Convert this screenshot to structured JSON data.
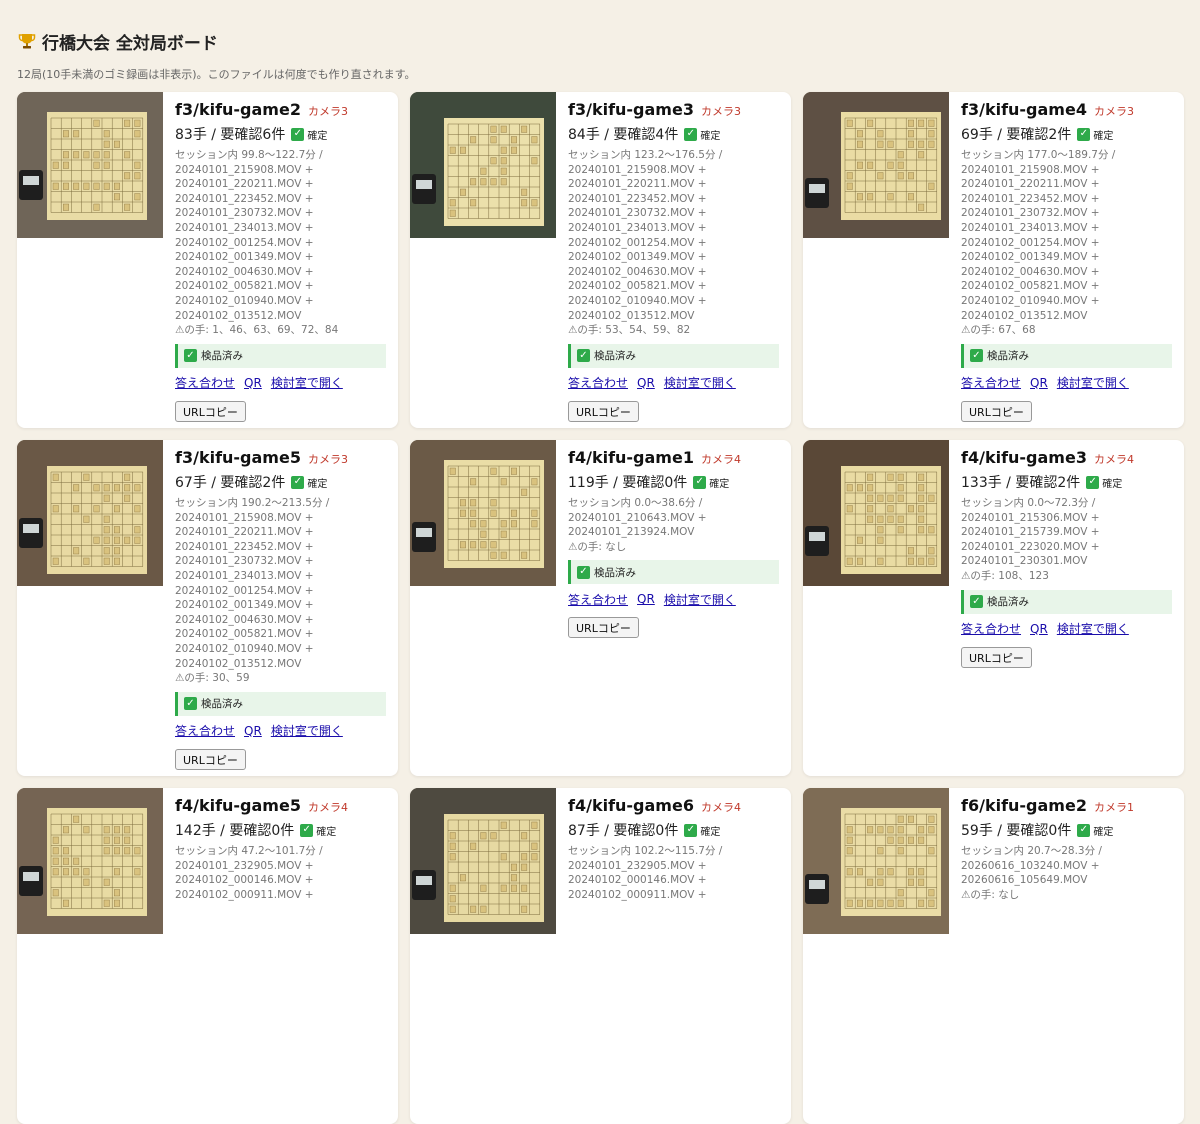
{
  "header": {
    "title": "行橋大会 全対局ボード",
    "subtitle": "12局(10手未満のゴミ録画は非表示)。このファイルは何度でも作り直されます。"
  },
  "common": {
    "confirmed_label": "確定",
    "inspected_label": "検品済み",
    "link_answer": "答え合わせ",
    "link_qr": "QR",
    "link_study": "検討室で開く",
    "url_copy": "URLコピー"
  },
  "cards": [
    {
      "name": "f3/kifu-game2",
      "camera": "カメラ3",
      "moves": "83手 / 要確認6件",
      "session": [
        "セッション内 99.8〜122.7分 /",
        "20240101_215908.MOV +",
        "20240101_220211.MOV +",
        "20240101_223452.MOV +",
        "20240101_230732.MOV +",
        "20240101_234013.MOV +",
        "20240102_001254.MOV +",
        "20240102_001349.MOV +",
        "20240102_004630.MOV +",
        "20240102_005821.MOV +",
        "20240102_010940.MOV +",
        "20240102_013512.MOV",
        "⚠の手: 1、46、63、69、72、84"
      ],
      "inspected": true
    },
    {
      "name": "f3/kifu-game3",
      "camera": "カメラ3",
      "moves": "84手 / 要確認4件",
      "session": [
        "セッション内 123.2〜176.5分 /",
        "20240101_215908.MOV +",
        "20240101_220211.MOV +",
        "20240101_223452.MOV +",
        "20240101_230732.MOV +",
        "20240101_234013.MOV +",
        "20240102_001254.MOV +",
        "20240102_001349.MOV +",
        "20240102_004630.MOV +",
        "20240102_005821.MOV +",
        "20240102_010940.MOV +",
        "20240102_013512.MOV",
        "⚠の手: 53、54、59、82"
      ],
      "inspected": true
    },
    {
      "name": "f3/kifu-game4",
      "camera": "カメラ3",
      "moves": "69手 / 要確認2件",
      "session": [
        "セッション内 177.0〜189.7分 /",
        "20240101_215908.MOV +",
        "20240101_220211.MOV +",
        "20240101_223452.MOV +",
        "20240101_230732.MOV +",
        "20240101_234013.MOV +",
        "20240102_001254.MOV +",
        "20240102_001349.MOV +",
        "20240102_004630.MOV +",
        "20240102_005821.MOV +",
        "20240102_010940.MOV +",
        "20240102_013512.MOV",
        "⚠の手: 67、68"
      ],
      "inspected": true
    },
    {
      "name": "f3/kifu-game5",
      "camera": "カメラ3",
      "moves": "67手 / 要確認2件",
      "session": [
        "セッション内 190.2〜213.5分 /",
        "20240101_215908.MOV +",
        "20240101_220211.MOV +",
        "20240101_223452.MOV +",
        "20240101_230732.MOV +",
        "20240101_234013.MOV +",
        "20240102_001254.MOV +",
        "20240102_001349.MOV +",
        "20240102_004630.MOV +",
        "20240102_005821.MOV +",
        "20240102_010940.MOV +",
        "20240102_013512.MOV",
        "⚠の手: 30、59"
      ],
      "inspected": true
    },
    {
      "name": "f4/kifu-game1",
      "camera": "カメラ4",
      "moves": "119手 / 要確認0件",
      "session": [
        "セッション内 0.0〜38.6分 /",
        "20240101_210643.MOV +",
        "20240101_213924.MOV",
        "⚠の手: なし"
      ],
      "inspected": true
    },
    {
      "name": "f4/kifu-game3",
      "camera": "カメラ4",
      "moves": "133手 / 要確認2件",
      "session": [
        "セッション内 0.0〜72.3分 /",
        "20240101_215306.MOV +",
        "20240101_215739.MOV +",
        "20240101_223020.MOV +",
        "20240101_230301.MOV",
        "⚠の手: 108、123"
      ],
      "inspected": true
    },
    {
      "name": "f4/kifu-game5",
      "camera": "カメラ4",
      "moves": "142手 / 要確認0件",
      "session": [
        "セッション内 47.2〜101.7分 /",
        "20240101_232905.MOV +",
        "20240102_000146.MOV +",
        "20240102_000911.MOV +"
      ],
      "inspected": false
    },
    {
      "name": "f4/kifu-game6",
      "camera": "カメラ4",
      "moves": "87手 / 要確認0件",
      "session": [
        "セッション内 102.2〜115.7分 /",
        "20240101_232905.MOV +",
        "20240102_000146.MOV +",
        "20240102_000911.MOV +"
      ],
      "inspected": false
    },
    {
      "name": "f6/kifu-game2",
      "camera": "カメラ1",
      "moves": "59手 / 要確認0件",
      "session": [
        "セッション内 20.7〜28.3分 /",
        "20260616_103240.MOV +",
        "20260616_105649.MOV",
        "⚠の手: なし"
      ],
      "inspected": false
    }
  ]
}
